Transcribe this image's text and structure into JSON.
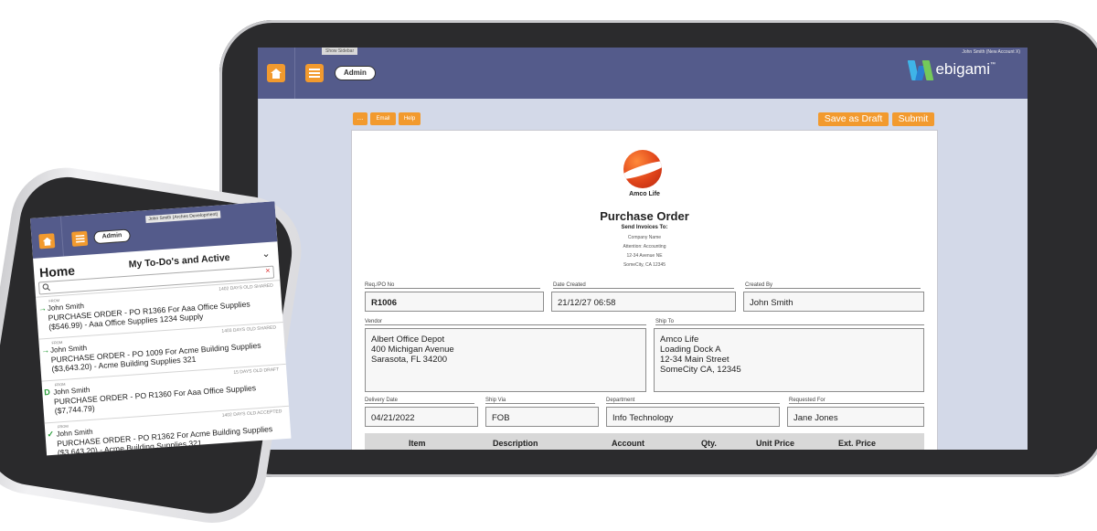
{
  "tablet": {
    "header": {
      "show_sidebar": "Show Sidebar",
      "admin_label": "Admin",
      "user": "John Smith (New Account X)",
      "logo_text": "ebigami",
      "logo_tm": "™"
    },
    "toolbar": {
      "more_label": "...",
      "email_label": "Email",
      "help_label": "Help",
      "save_draft_label": "Save as Draft",
      "submit_label": "Submit"
    },
    "document": {
      "company_logo_name": "Amco Life",
      "title": "Purchase Order",
      "send_invoices": "Send Invoices To:",
      "address_lines": [
        "Company Name",
        "Attention: Accounting",
        "12-34 Avenue NE",
        "SomeCity, CA 12345"
      ],
      "fields": {
        "req_label": "Req./PO No",
        "req_value": "R1006",
        "date_label": "Date Created",
        "date_value": "21/12/27 06:58",
        "created_label": "Created By",
        "created_value": "John Smith",
        "vendor_label": "Vendor",
        "vendor_value": "Albert Office Depot\n400 Michigan Avenue\nSarasota, FL 34200",
        "shipto_label": "Ship To",
        "shipto_value": "Amco Life\nLoading Dock A\n12-34 Main Street\nSomeCity CA, 12345",
        "delivery_label": "Delivery Date",
        "delivery_value": "04/21/2022",
        "shipvia_label": "Ship Via",
        "shipvia_value": "FOB",
        "dept_label": "Department",
        "dept_value": "Info Technology",
        "reqfor_label": "Requested For",
        "reqfor_value": "Jane Jones"
      },
      "table_headers": [
        "Item",
        "Description",
        "Account",
        "Qty.",
        "Unit Price",
        "Ext. Price"
      ]
    }
  },
  "phone": {
    "header": {
      "admin_label": "Admin",
      "user": "John Smith (Arches Development)"
    },
    "home_title": "Home",
    "filter_label": "My To-Do's and Active",
    "items": [
      {
        "from": "FROM",
        "meta": "1402 DAYS OLD   SHARED",
        "mark": "→",
        "name": "John Smith",
        "desc": "PURCHASE ORDER - PO R1366 For Aaa Office Supplies ($546.99) - Aaa Office Supplies 1234 Supply"
      },
      {
        "from": "FROM",
        "meta": "1403 DAYS OLD   SHARED",
        "mark": "→",
        "name": "John Smith",
        "desc": "PURCHASE ORDER - PO 1009 For Acme Building Supplies ($3,643.20) - Acme Building Supplies 321"
      },
      {
        "from": "FROM",
        "meta": "15 DAYS OLD   DRAFT",
        "mark": "D",
        "name": "John Smith",
        "desc": "PURCHASE ORDER - PO R1360 For Aaa Office Supplies ($7,744.79)"
      },
      {
        "from": "FROM",
        "meta": "1402 DAYS OLD   ACCEPTED",
        "mark": "✓",
        "name": "John Smith",
        "desc": "PURCHASE ORDER - PO R1362 For Acme Building Supplies ($3,643.20) - Acme Building Supplies 321"
      }
    ]
  },
  "colors": {
    "header_bg": "#545b8b",
    "accent_orange": "#f29a2e",
    "content_bg": "#d3d9e8",
    "arrow_green": "#2a9d3a"
  }
}
